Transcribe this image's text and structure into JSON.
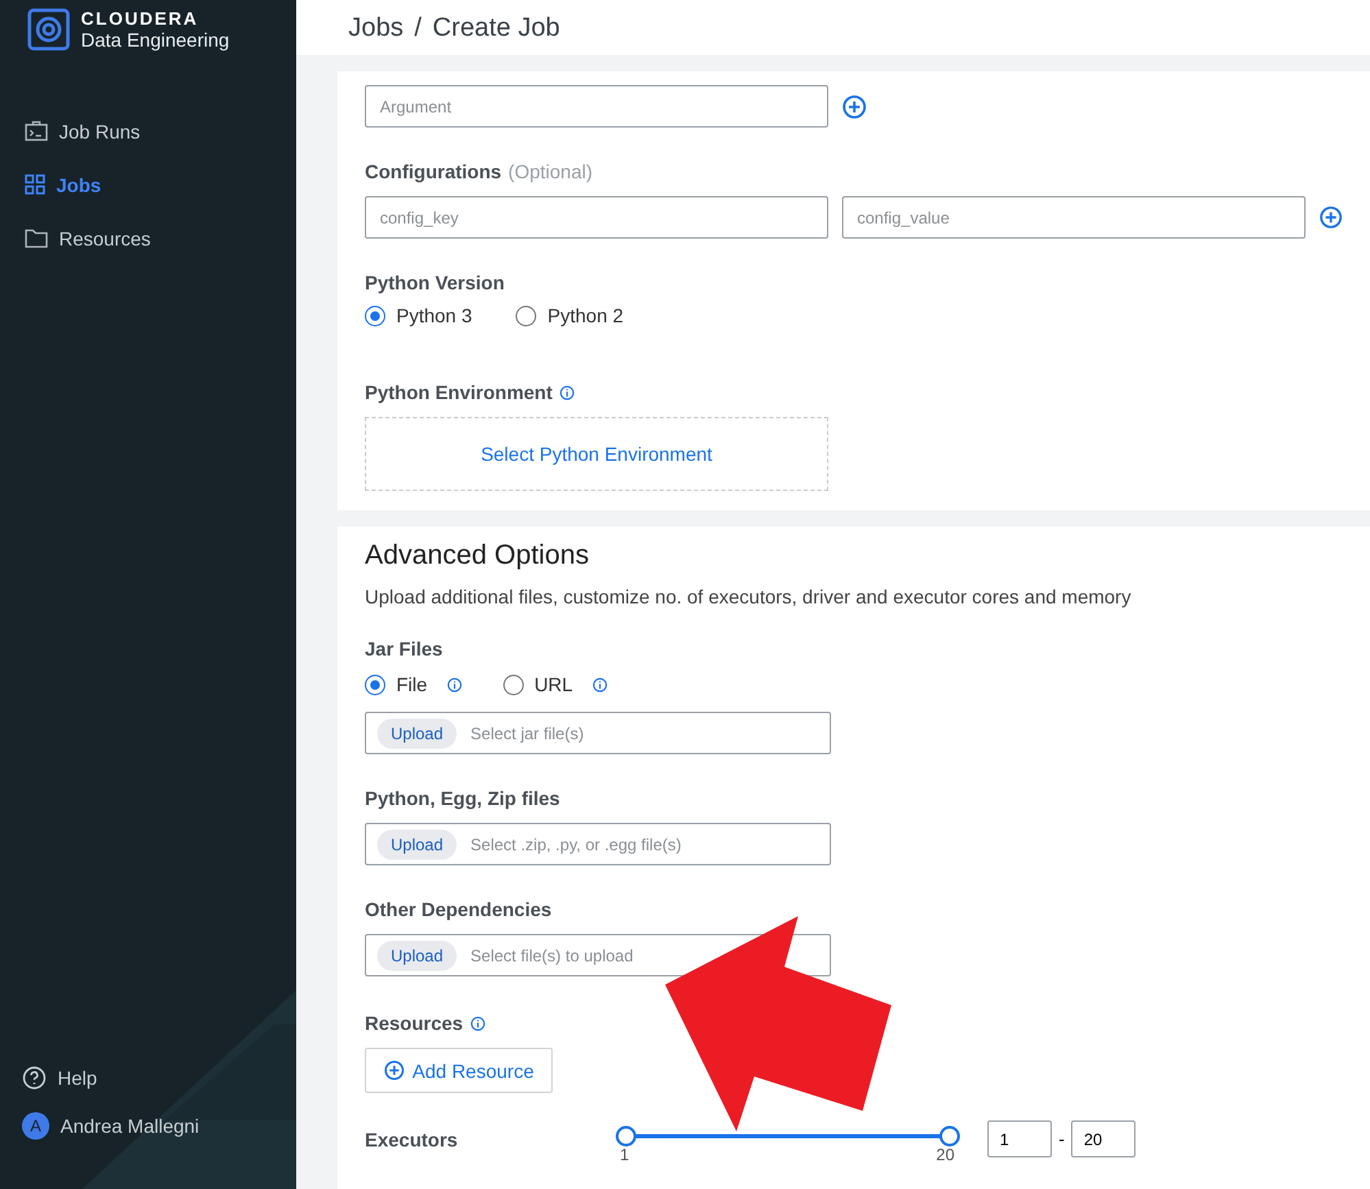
{
  "sidebar": {
    "brand": {
      "name": "CLOUDERA",
      "product": "Data Engineering"
    },
    "items": [
      {
        "label": "Job Runs",
        "selected": false
      },
      {
        "label": "Jobs",
        "selected": true
      },
      {
        "label": "Resources",
        "selected": false
      }
    ],
    "footer": {
      "help": "Help",
      "user": {
        "initial": "A",
        "name": "Andrea Mallegni"
      }
    }
  },
  "breadcrumb": [
    "Jobs",
    "Create Job"
  ],
  "breadcrumb_separator": "/",
  "job_section": {
    "argument_placeholder": "Argument",
    "configurations": {
      "label": "Configurations",
      "optional": "(Optional)",
      "key_placeholder": "config_key",
      "value_placeholder": "config_value"
    },
    "python_version": {
      "label": "Python Version",
      "options": [
        {
          "label": "Python 3",
          "selected": true
        },
        {
          "label": "Python 2",
          "selected": false
        }
      ]
    },
    "python_environment": {
      "label": "Python Environment",
      "action": "Select Python Environment"
    }
  },
  "advanced": {
    "title": "Advanced Options",
    "description": "Upload additional files, customize no. of executors, driver and executor cores and memory",
    "jar_files": {
      "label": "Jar Files",
      "options": [
        {
          "label": "File",
          "selected": true
        },
        {
          "label": "URL",
          "selected": false
        }
      ]
    },
    "uploads": [
      {
        "button": "Upload",
        "placeholder": "Select jar file(s)"
      },
      {
        "label": "Python, Egg, Zip files",
        "button": "Upload",
        "placeholder": "Select .zip, .py, or .egg file(s)"
      },
      {
        "label": "Other Dependencies",
        "button": "Upload",
        "placeholder": "Select file(s) to upload"
      }
    ],
    "resources": {
      "label": "Resources",
      "button": "Add Resource"
    },
    "executors": {
      "label": "Executors",
      "thumbs": [
        {
          "level": 0
        },
        {
          "level": 1
        }
      ],
      "min_label": "1",
      "max_label": "20",
      "min_value": "1",
      "separator": "-",
      "max_value": "20"
    }
  }
}
